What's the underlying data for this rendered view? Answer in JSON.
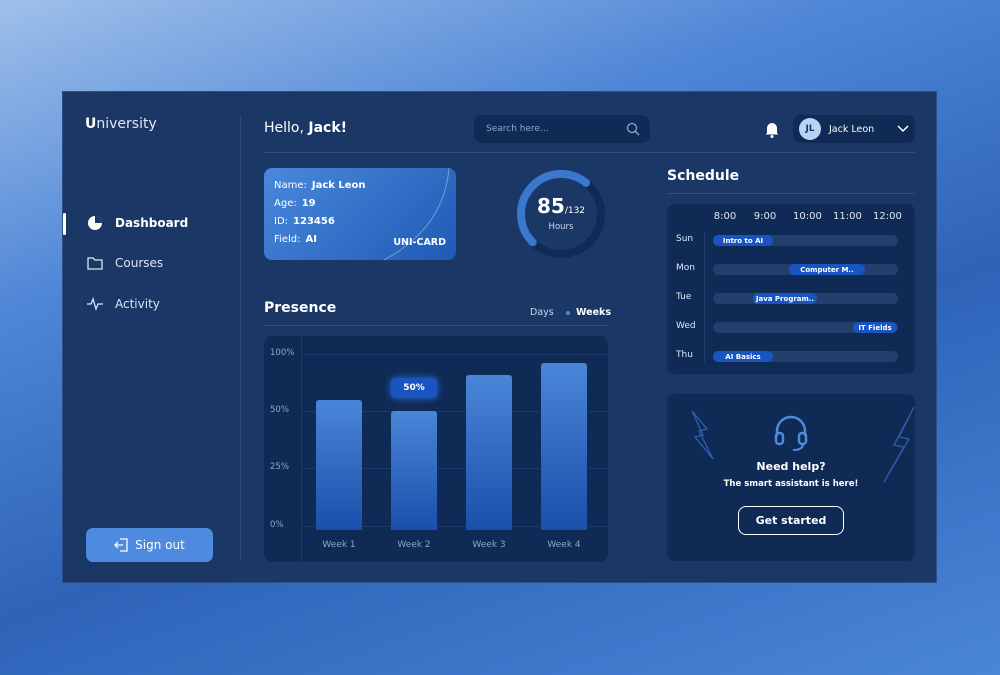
{
  "app": {
    "logo_initial": "U",
    "logo_rest": "niversity"
  },
  "sidebar": {
    "items": [
      {
        "label": "Dashboard",
        "icon": "pie-chart-icon",
        "active": true
      },
      {
        "label": "Courses",
        "icon": "folder-icon"
      },
      {
        "label": "Activity",
        "icon": "activity-icon"
      }
    ],
    "sign_out": "Sign out"
  },
  "header": {
    "greeting": "Hello, ",
    "name": "Jack!",
    "search_placeholder": "Search here...",
    "user_initials": "JL",
    "user_name": "Jack Leon"
  },
  "card": {
    "name_label": "Name:",
    "name": "Jack Leon",
    "age_label": "Age:",
    "age": "19",
    "id_label": "ID:",
    "id": "123456",
    "field_label": "Field:",
    "field": "AI",
    "brand": "UNI-CARD"
  },
  "hours": {
    "value": "85",
    "total": "/132",
    "label": "Hours",
    "done": 85,
    "max": 132
  },
  "presence": {
    "title": "Presence",
    "toggle_days": "Days",
    "toggle_weeks": "Weeks",
    "selected": "Weeks"
  },
  "chart_data": {
    "type": "bar",
    "categories": [
      "Week 1",
      "Week 2",
      "Week 3",
      "Week 4"
    ],
    "values": [
      60,
      50,
      82,
      92
    ],
    "y_ticks": [
      "100%",
      "50%",
      "25%",
      "0%"
    ],
    "tooltip": "50%",
    "tooltip_index": 1,
    "color": "#3f7bd2"
  },
  "schedule": {
    "title": "Schedule",
    "times": [
      "8:00",
      "9:00",
      "10:00",
      "11:00",
      "12:00"
    ],
    "rows": [
      {
        "day": "Sun",
        "event": "Intro to AI",
        "start": 7.7,
        "end": 9.2
      },
      {
        "day": "Mon",
        "event": "Computer M..",
        "start": 9.6,
        "end": 11.5
      },
      {
        "day": "Tue",
        "event": "Java Program..",
        "start": 8.7,
        "end": 10.3
      },
      {
        "day": "Wed",
        "event": "IT Fields",
        "start": 11.2,
        "end": 12.3
      },
      {
        "day": "Thu",
        "event": "AI Basics",
        "start": 7.7,
        "end": 9.2
      }
    ]
  },
  "help": {
    "title": "Need help?",
    "subtitle": "The smart assistant is here!",
    "button": "Get started"
  }
}
